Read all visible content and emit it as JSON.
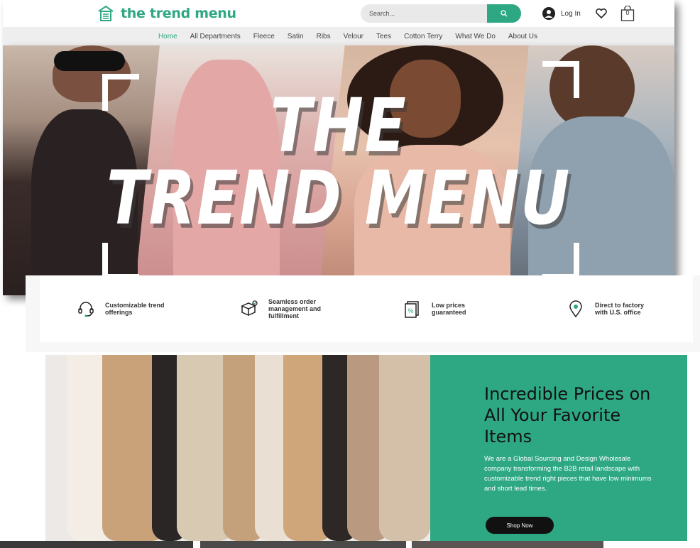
{
  "header": {
    "brand": "the trend menu",
    "search_placeholder": "Search...",
    "login_label": "Log In",
    "cart_count": "0"
  },
  "nav": {
    "items": [
      {
        "label": "Home",
        "active": true
      },
      {
        "label": "All Departments",
        "active": false
      },
      {
        "label": "Fleece",
        "active": false
      },
      {
        "label": "Satin",
        "active": false
      },
      {
        "label": "Ribs",
        "active": false
      },
      {
        "label": "Velour",
        "active": false
      },
      {
        "label": "Tees",
        "active": false
      },
      {
        "label": "Cotton Terry",
        "active": false
      },
      {
        "label": "What We Do",
        "active": false
      },
      {
        "label": "About Us",
        "active": false
      }
    ]
  },
  "hero": {
    "title_line1": "THE",
    "title_line2": "TREND MENU"
  },
  "features": [
    {
      "icon": "headset-icon",
      "text": "Customizable trend offerings"
    },
    {
      "icon": "box-icon",
      "text": "Seamless order management and fulfillment"
    },
    {
      "icon": "price-tag-icon",
      "text": "Low prices guaranteed"
    },
    {
      "icon": "location-pin-icon",
      "text": "Direct to factory with U.S. office"
    }
  ],
  "promo": {
    "title": "Incredible Prices on All Your Favorite Items",
    "body": "We are a Global Sourcing and Design Wholesale company transforming the B2B retail landscape with customizable trend right pieces that have low minimums and short lead times.",
    "button_label": "Shop Now"
  },
  "colors": {
    "accent": "#2ea883",
    "nav_bg": "#eeeeee",
    "button_dark": "#111111"
  }
}
